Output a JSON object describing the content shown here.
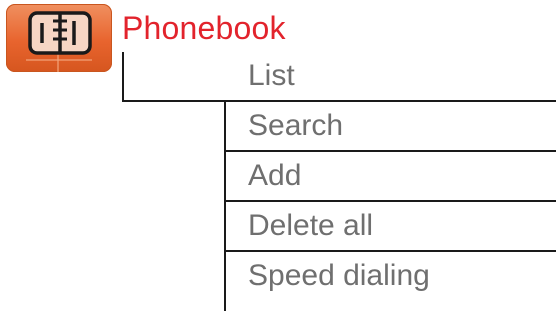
{
  "header": {
    "title": "Phonebook",
    "icon": "phonebook-icon",
    "title_color": "#e2232c",
    "icon_color": "#e8642e"
  },
  "menu": {
    "items": [
      {
        "label": "List"
      },
      {
        "label": "Search"
      },
      {
        "label": "Add"
      },
      {
        "label": "Delete all"
      },
      {
        "label": "Speed dialing"
      }
    ],
    "label_color": "#6f6f6f"
  }
}
